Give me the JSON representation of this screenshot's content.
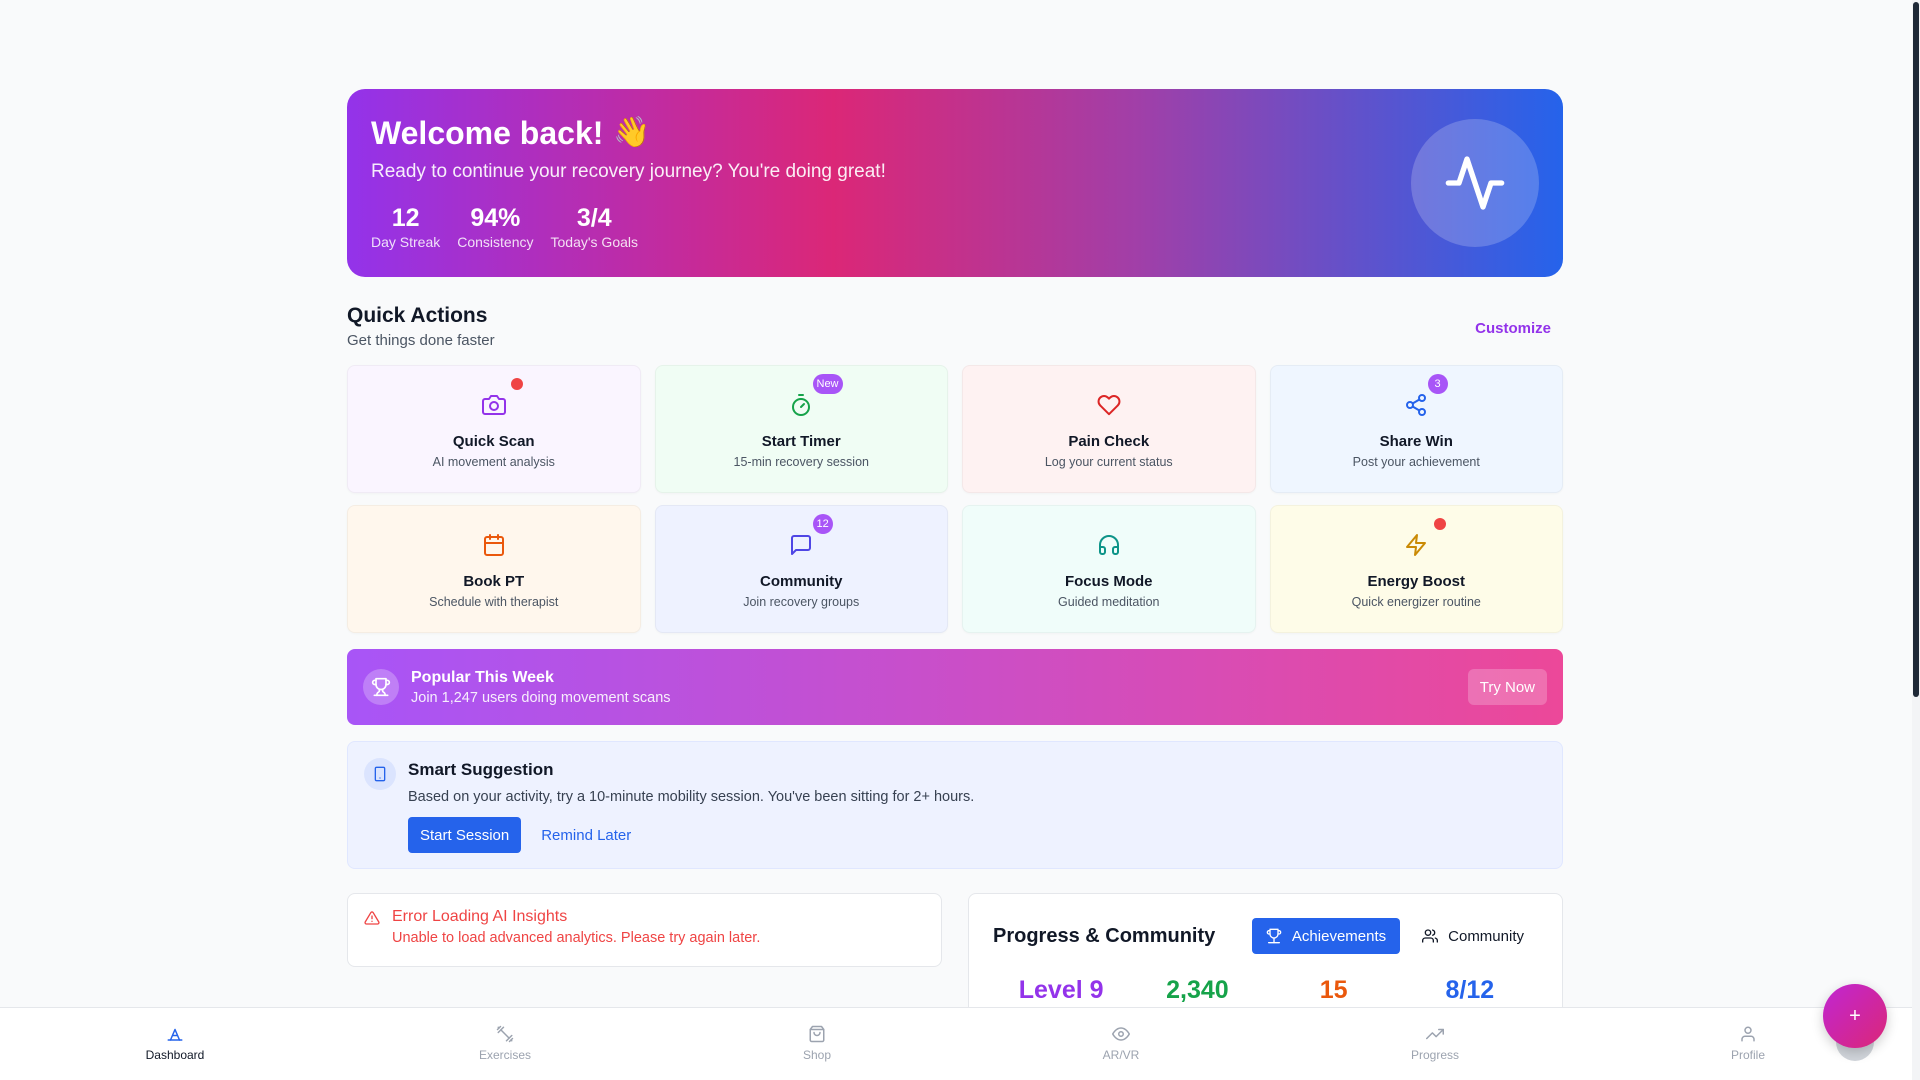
{
  "hero": {
    "title": "Welcome back!",
    "emoji": "👋",
    "subtitle": "Ready to continue your recovery journey? You're doing great!",
    "stats": [
      {
        "value": "12",
        "label": "Day Streak"
      },
      {
        "value": "94%",
        "label": "Consistency"
      },
      {
        "value": "3/4",
        "label": "Today's Goals"
      }
    ],
    "icon": "activity-icon"
  },
  "quick_actions": {
    "title": "Quick Actions",
    "subtitle": "Get things done faster",
    "customize_label": "Customize",
    "tiles": [
      {
        "title": "Quick Scan",
        "subtitle": "AI movement analysis",
        "icon": "camera-icon",
        "badge": "dot",
        "bg": "#faf5ff",
        "color": "#9333ea"
      },
      {
        "title": "Start Timer",
        "subtitle": "15-min recovery session",
        "icon": "timer-icon",
        "badge": "New",
        "bg": "#f0fdf4",
        "color": "#16a34a"
      },
      {
        "title": "Pain Check",
        "subtitle": "Log your current status",
        "icon": "heart-icon",
        "badge": "",
        "bg": "#fef2f2",
        "color": "#dc2626"
      },
      {
        "title": "Share Win",
        "subtitle": "Post your achievement",
        "icon": "share-icon",
        "badge": "3",
        "bg": "#eff6ff",
        "color": "#2563eb"
      },
      {
        "title": "Book PT",
        "subtitle": "Schedule with therapist",
        "icon": "calendar-icon",
        "badge": "",
        "bg": "#fff7ed",
        "color": "#ea580c"
      },
      {
        "title": "Community",
        "subtitle": "Join recovery groups",
        "icon": "message-icon",
        "badge": "12",
        "bg": "#eef2ff",
        "color": "#4f46e5"
      },
      {
        "title": "Focus Mode",
        "subtitle": "Guided meditation",
        "icon": "headphones-icon",
        "badge": "",
        "bg": "#f0fdfa",
        "color": "#0d9488"
      },
      {
        "title": "Energy Boost",
        "subtitle": "Quick energizer routine",
        "icon": "zap-icon",
        "badge": "dot",
        "bg": "#fefce8",
        "color": "#ca8a04"
      }
    ]
  },
  "popular": {
    "title": "Popular This Week",
    "subtitle": "Join 1,247 users doing movement scans",
    "button": "Try Now",
    "icon": "trophy-icon"
  },
  "smart": {
    "title": "Smart Suggestion",
    "text": "Based on your activity, try a 10-minute mobility session. You've been sitting for 2+ hours.",
    "primary": "Start Session",
    "secondary": "Remind Later",
    "icon": "smartphone-icon"
  },
  "error": {
    "title": "Error Loading AI Insights",
    "subtitle": "Unable to load advanced analytics. Please try again later.",
    "icon": "alert-triangle-icon"
  },
  "progress": {
    "title": "Progress & Community",
    "tabs": [
      "Achievements",
      "Community"
    ],
    "active_tab": "Achievements",
    "stats": [
      {
        "value": "Level 9",
        "color": "#9333ea"
      },
      {
        "value": "2,340",
        "color": "#16a34a"
      },
      {
        "value": "15",
        "color": "#ea580c"
      },
      {
        "value": "8/12",
        "color": "#2563eb"
      }
    ]
  },
  "nav": {
    "items": [
      {
        "label": "Dashboard",
        "icon": "dashboard-icon",
        "active": true
      },
      {
        "label": "Exercises",
        "icon": "dumbbell-icon",
        "active": false
      },
      {
        "label": "Shop",
        "icon": "shopping-bag-icon",
        "active": false
      },
      {
        "label": "AR/VR",
        "icon": "eye-icon",
        "active": false
      },
      {
        "label": "Progress",
        "icon": "trending-up-icon",
        "active": false
      },
      {
        "label": "Profile",
        "icon": "user-icon",
        "active": false
      }
    ]
  },
  "fab": {
    "label": "+",
    "icon": "plus-icon"
  }
}
